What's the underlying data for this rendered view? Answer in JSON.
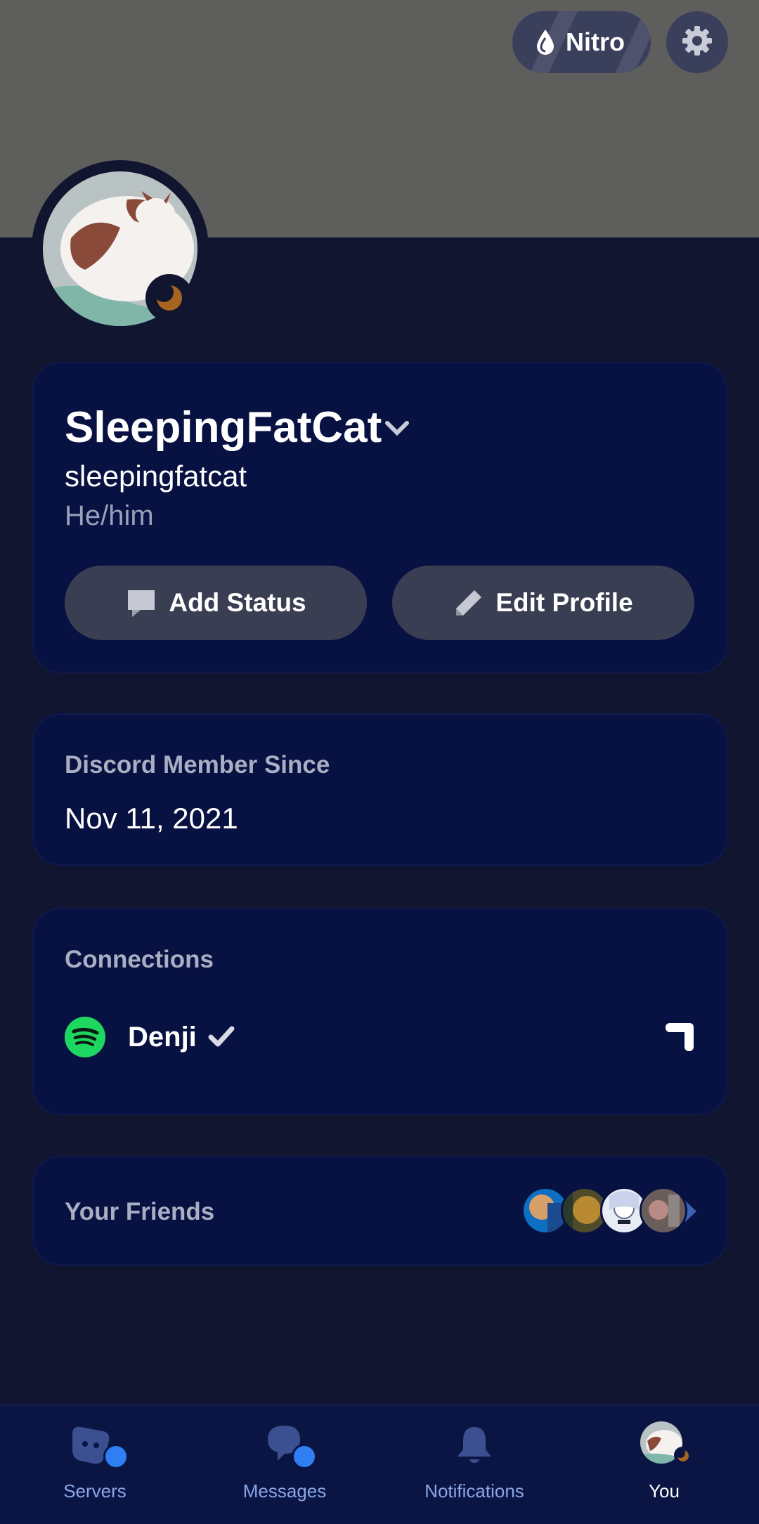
{
  "header": {
    "nitro_label": "Nitro"
  },
  "profile": {
    "display_name": "SleepingFatCat",
    "username": "sleepingfatcat",
    "pronouns": "He/him",
    "add_status_label": "Add Status",
    "edit_profile_label": "Edit Profile"
  },
  "member_since": {
    "title": "Discord Member Since",
    "date": "Nov 11, 2021"
  },
  "connections": {
    "title": "Connections",
    "items": [
      {
        "service": "spotify-icon",
        "name": "Denji"
      }
    ]
  },
  "friends": {
    "title": "Your Friends"
  },
  "nav": {
    "items": [
      {
        "label": "Servers",
        "icon": "servers-icon"
      },
      {
        "label": "Messages",
        "icon": "messages-icon"
      },
      {
        "label": "Notifications",
        "icon": "bell-icon"
      },
      {
        "label": "You",
        "icon": "avatar"
      }
    ]
  },
  "colors": {
    "background": "#11152f",
    "banner": "#5e5e5c",
    "card": "#081242",
    "button": "#3a3e52",
    "accent_badge": "#2f7ef3",
    "spotify": "#1ed760",
    "nav_label": "#8aa6e6"
  }
}
